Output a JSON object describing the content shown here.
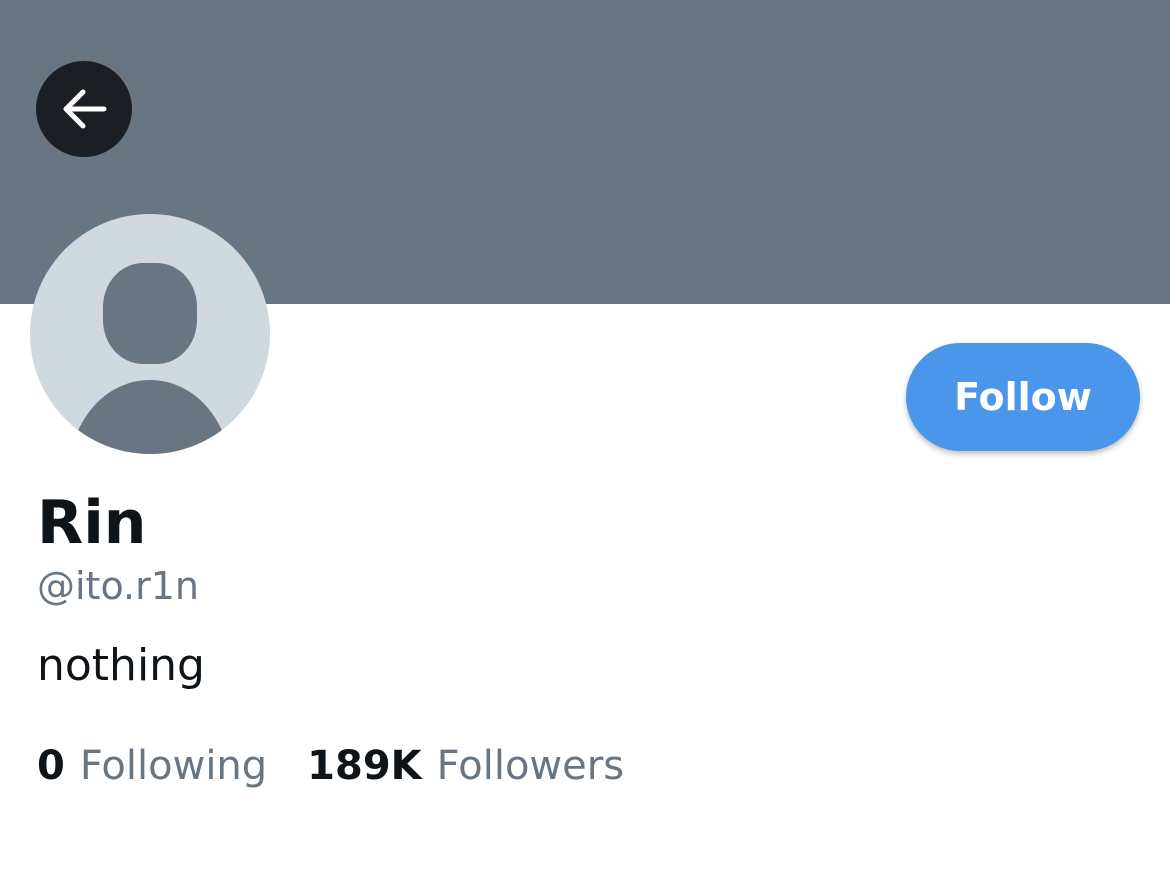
{
  "header": {
    "banner_color": "#687684",
    "back_icon": "arrow-left-icon"
  },
  "profile": {
    "avatar_icon": "default-avatar-icon",
    "display_name": "Rin",
    "username": "@ito.r1n",
    "bio": "nothing",
    "follow_label": "Follow",
    "follow_color": "#4a96ea"
  },
  "stats": {
    "following_count": "0",
    "following_label": "Following",
    "followers_count": "189K",
    "followers_label": "Followers"
  }
}
